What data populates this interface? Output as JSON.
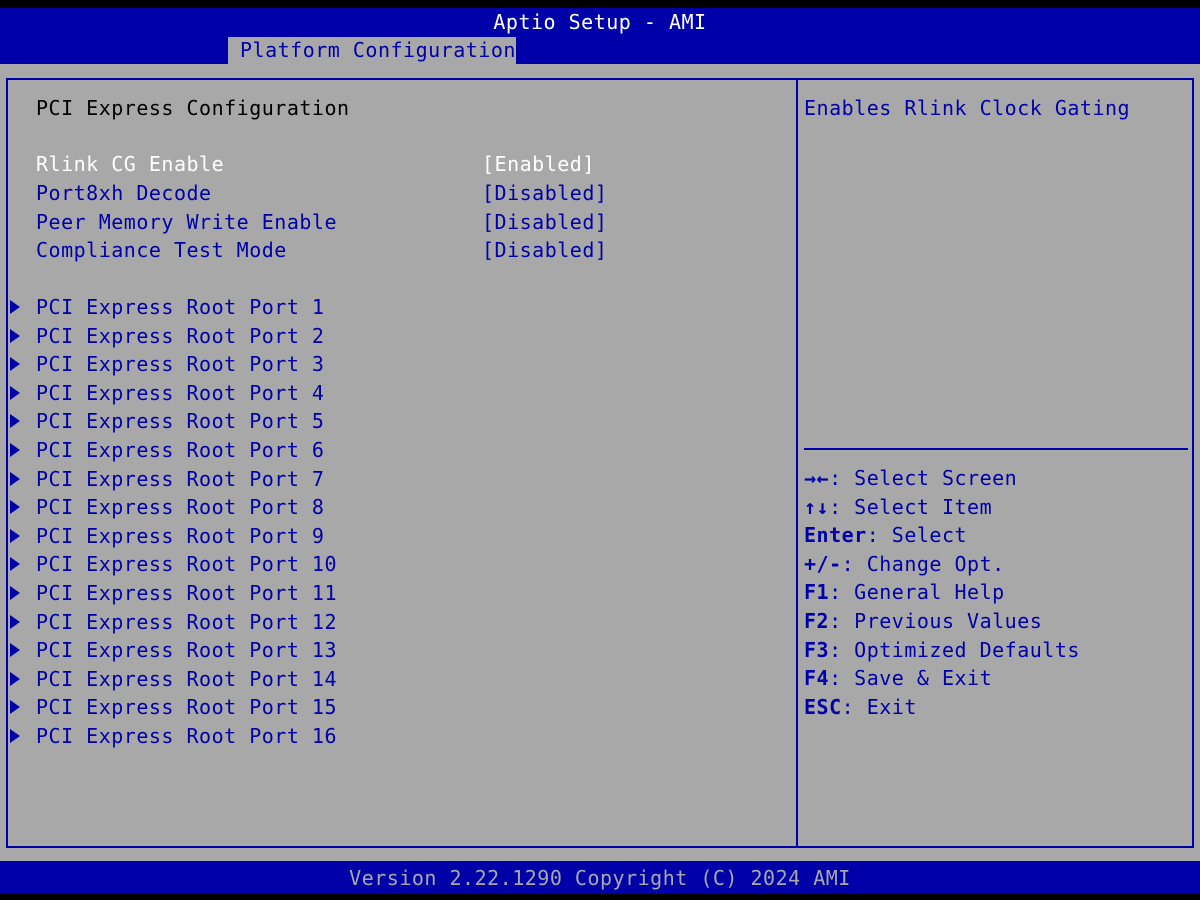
{
  "header": {
    "title": "Aptio Setup - AMI",
    "active_tab": "Platform Configuration"
  },
  "section_title": "PCI Express Configuration",
  "options": [
    {
      "label": "Rlink CG Enable",
      "value": "[Enabled]",
      "selected": true
    },
    {
      "label": "Port8xh Decode",
      "value": "[Disabled]",
      "selected": false
    },
    {
      "label": "Peer Memory Write Enable",
      "value": "[Disabled]",
      "selected": false
    },
    {
      "label": "Compliance Test Mode",
      "value": "[Disabled]",
      "selected": false
    }
  ],
  "submenus": [
    "PCI Express Root Port 1",
    "PCI Express Root Port 2",
    "PCI Express Root Port 3",
    "PCI Express Root Port 4",
    "PCI Express Root Port 5",
    "PCI Express Root Port 6",
    "PCI Express Root Port 7",
    "PCI Express Root Port 8",
    "PCI Express Root Port 9",
    "PCI Express Root Port 10",
    "PCI Express Root Port 11",
    "PCI Express Root Port 12",
    "PCI Express Root Port 13",
    "PCI Express Root Port 14",
    "PCI Express Root Port 15",
    "PCI Express Root Port 16"
  ],
  "submenu_icon": "triangle-right-icon",
  "help": {
    "text": "Enables Rlink Clock Gating"
  },
  "keys": [
    {
      "key": "→←",
      "desc": ": Select Screen"
    },
    {
      "key": "↑↓",
      "desc": ": Select Item"
    },
    {
      "key": "Enter",
      "desc": ": Select"
    },
    {
      "key": "+/-",
      "desc": ": Change Opt."
    },
    {
      "key": "F1",
      "desc": ": General Help"
    },
    {
      "key": "F2",
      "desc": ": Previous Values"
    },
    {
      "key": "F3",
      "desc": ": Optimized Defaults"
    },
    {
      "key": "F4",
      "desc": ": Save & Exit"
    },
    {
      "key": "ESC",
      "desc": ": Exit"
    }
  ],
  "footer": {
    "version": "Version 2.22.1290 Copyright (C) 2024 AMI"
  },
  "colors": {
    "bios_blue": "#0000a8",
    "bios_gray": "#a8a8a8",
    "highlight": "#ffffff"
  }
}
